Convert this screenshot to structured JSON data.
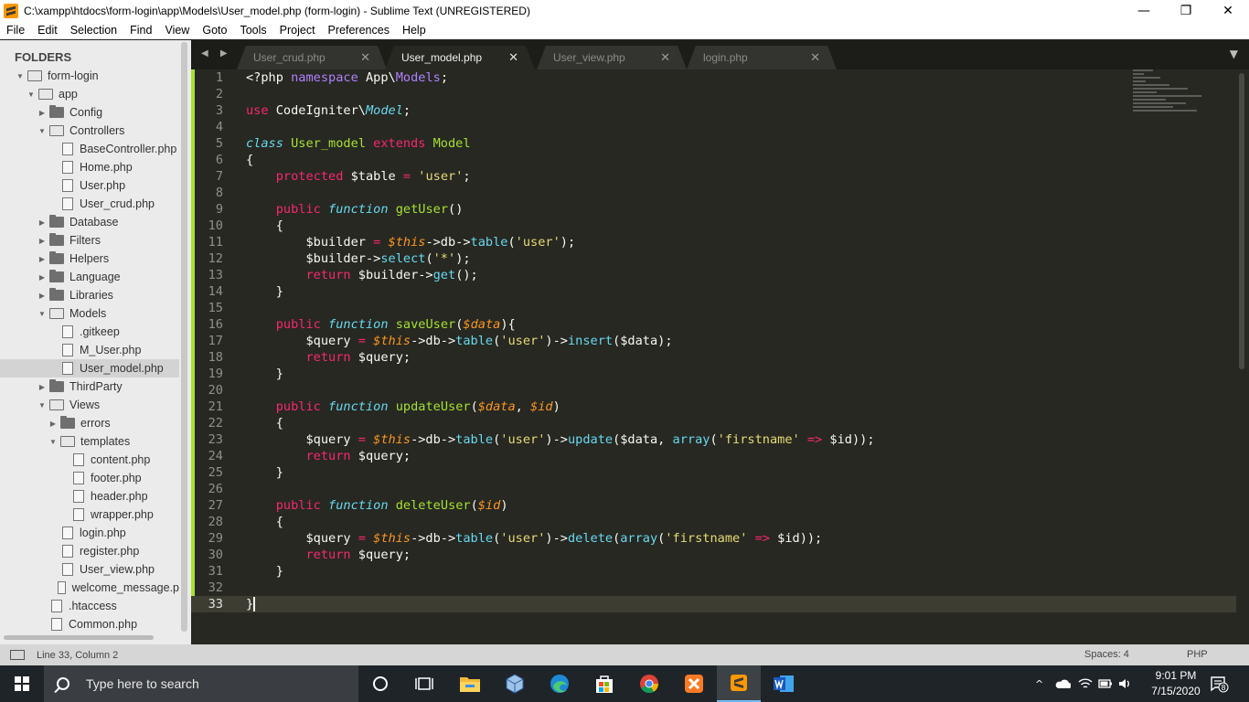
{
  "window": {
    "title": "C:\\xampp\\htdocs\\form-login\\app\\Models\\User_model.php (form-login) - Sublime Text (UNREGISTERED)",
    "minimize": "—",
    "maximize": "❐",
    "close": "✕"
  },
  "menu": [
    "File",
    "Edit",
    "Selection",
    "Find",
    "View",
    "Goto",
    "Tools",
    "Project",
    "Preferences",
    "Help"
  ],
  "sidebar": {
    "title": "FOLDERS",
    "tree": [
      {
        "label": "form-login",
        "type": "folder-open",
        "depth": 0,
        "twisty": "▼"
      },
      {
        "label": "app",
        "type": "folder-open",
        "depth": 1,
        "twisty": "▼"
      },
      {
        "label": "Config",
        "type": "folder",
        "depth": 2,
        "twisty": "▶"
      },
      {
        "label": "Controllers",
        "type": "folder-open",
        "depth": 2,
        "twisty": "▼"
      },
      {
        "label": "BaseController.php",
        "type": "file",
        "depth": 3
      },
      {
        "label": "Home.php",
        "type": "file",
        "depth": 3
      },
      {
        "label": "User.php",
        "type": "file",
        "depth": 3
      },
      {
        "label": "User_crud.php",
        "type": "file",
        "depth": 3
      },
      {
        "label": "Database",
        "type": "folder",
        "depth": 2,
        "twisty": "▶"
      },
      {
        "label": "Filters",
        "type": "folder",
        "depth": 2,
        "twisty": "▶"
      },
      {
        "label": "Helpers",
        "type": "folder",
        "depth": 2,
        "twisty": "▶"
      },
      {
        "label": "Language",
        "type": "folder",
        "depth": 2,
        "twisty": "▶"
      },
      {
        "label": "Libraries",
        "type": "folder",
        "depth": 2,
        "twisty": "▶"
      },
      {
        "label": "Models",
        "type": "folder-open",
        "depth": 2,
        "twisty": "▼"
      },
      {
        "label": ".gitkeep",
        "type": "file",
        "depth": 3
      },
      {
        "label": "M_User.php",
        "type": "file",
        "depth": 3
      },
      {
        "label": "User_model.php",
        "type": "file",
        "depth": 3,
        "selected": true
      },
      {
        "label": "ThirdParty",
        "type": "folder",
        "depth": 2,
        "twisty": "▶"
      },
      {
        "label": "Views",
        "type": "folder-open",
        "depth": 2,
        "twisty": "▼"
      },
      {
        "label": "errors",
        "type": "folder",
        "depth": 3,
        "twisty": "▶"
      },
      {
        "label": "templates",
        "type": "folder-open",
        "depth": 3,
        "twisty": "▼"
      },
      {
        "label": "content.php",
        "type": "file",
        "depth": 4
      },
      {
        "label": "footer.php",
        "type": "file",
        "depth": 4
      },
      {
        "label": "header.php",
        "type": "file",
        "depth": 4
      },
      {
        "label": "wrapper.php",
        "type": "file",
        "depth": 4
      },
      {
        "label": "login.php",
        "type": "file",
        "depth": 3
      },
      {
        "label": "register.php",
        "type": "file",
        "depth": 3
      },
      {
        "label": "User_view.php",
        "type": "file",
        "depth": 3
      },
      {
        "label": "welcome_message.p",
        "type": "file",
        "depth": 3
      },
      {
        "label": ".htaccess",
        "type": "file",
        "depth": 2
      },
      {
        "label": "Common.php",
        "type": "file",
        "depth": 2
      }
    ]
  },
  "tabs": {
    "nav": "◀ ▶",
    "dropdown": "▼",
    "close": "✕",
    "items": [
      {
        "label": "User_crud.php",
        "active": false
      },
      {
        "label": "User_model.php",
        "active": true
      },
      {
        "label": "User_view.php",
        "active": false
      },
      {
        "label": "login.php",
        "active": false
      }
    ]
  },
  "editor": {
    "current_line": 33,
    "lines": [
      [
        {
          "t": "<?php "
        },
        {
          "t": "namespace",
          "c": "st"
        },
        {
          "t": " App\\"
        },
        {
          "t": "Models",
          "c": "st"
        },
        {
          "t": ";"
        }
      ],
      [],
      [
        {
          "t": "use",
          "c": "k"
        },
        {
          "t": " CodeIgniter\\"
        },
        {
          "t": "Model",
          "c": "t"
        },
        {
          "t": ";"
        }
      ],
      [],
      [
        {
          "t": "class",
          "c": "t"
        },
        {
          "t": " "
        },
        {
          "t": "User_model",
          "c": "f"
        },
        {
          "t": " "
        },
        {
          "t": "extends",
          "c": "k"
        },
        {
          "t": " "
        },
        {
          "t": "Model",
          "c": "f"
        }
      ],
      [
        {
          "t": "{"
        }
      ],
      [
        {
          "t": "    "
        },
        {
          "t": "protected",
          "c": "k"
        },
        {
          "t": " $table "
        },
        {
          "t": "=",
          "c": "k"
        },
        {
          "t": " "
        },
        {
          "t": "'user'",
          "c": "s"
        },
        {
          "t": ";"
        }
      ],
      [],
      [
        {
          "t": "    "
        },
        {
          "t": "public",
          "c": "k"
        },
        {
          "t": " "
        },
        {
          "t": "function",
          "c": "t"
        },
        {
          "t": " "
        },
        {
          "t": "getUser",
          "c": "f"
        },
        {
          "t": "()"
        }
      ],
      [
        {
          "t": "    {"
        }
      ],
      [
        {
          "t": "        $builder "
        },
        {
          "t": "=",
          "c": "k"
        },
        {
          "t": " "
        },
        {
          "t": "$this",
          "c": "p"
        },
        {
          "t": "->db->"
        },
        {
          "t": "table",
          "c": "c"
        },
        {
          "t": "("
        },
        {
          "t": "'user'",
          "c": "s"
        },
        {
          "t": ");"
        }
      ],
      [
        {
          "t": "        $builder->"
        },
        {
          "t": "select",
          "c": "c"
        },
        {
          "t": "("
        },
        {
          "t": "'*'",
          "c": "s"
        },
        {
          "t": ");"
        }
      ],
      [
        {
          "t": "        "
        },
        {
          "t": "return",
          "c": "k"
        },
        {
          "t": " $builder->"
        },
        {
          "t": "get",
          "c": "c"
        },
        {
          "t": "();"
        }
      ],
      [
        {
          "t": "    }"
        }
      ],
      [],
      [
        {
          "t": "    "
        },
        {
          "t": "public",
          "c": "k"
        },
        {
          "t": " "
        },
        {
          "t": "function",
          "c": "t"
        },
        {
          "t": " "
        },
        {
          "t": "saveUser",
          "c": "f"
        },
        {
          "t": "("
        },
        {
          "t": "$data",
          "c": "p"
        },
        {
          "t": "){"
        }
      ],
      [
        {
          "t": "        $query "
        },
        {
          "t": "=",
          "c": "k"
        },
        {
          "t": " "
        },
        {
          "t": "$this",
          "c": "p"
        },
        {
          "t": "->db->"
        },
        {
          "t": "table",
          "c": "c"
        },
        {
          "t": "("
        },
        {
          "t": "'user'",
          "c": "s"
        },
        {
          "t": ")->"
        },
        {
          "t": "insert",
          "c": "c"
        },
        {
          "t": "($data);"
        }
      ],
      [
        {
          "t": "        "
        },
        {
          "t": "return",
          "c": "k"
        },
        {
          "t": " $query;"
        }
      ],
      [
        {
          "t": "    }"
        }
      ],
      [],
      [
        {
          "t": "    "
        },
        {
          "t": "public",
          "c": "k"
        },
        {
          "t": " "
        },
        {
          "t": "function",
          "c": "t"
        },
        {
          "t": " "
        },
        {
          "t": "updateUser",
          "c": "f"
        },
        {
          "t": "("
        },
        {
          "t": "$data",
          "c": "p"
        },
        {
          "t": ", "
        },
        {
          "t": "$id",
          "c": "p"
        },
        {
          "t": ")"
        }
      ],
      [
        {
          "t": "    {"
        }
      ],
      [
        {
          "t": "        $query "
        },
        {
          "t": "=",
          "c": "k"
        },
        {
          "t": " "
        },
        {
          "t": "$this",
          "c": "p"
        },
        {
          "t": "->db->"
        },
        {
          "t": "table",
          "c": "c"
        },
        {
          "t": "("
        },
        {
          "t": "'user'",
          "c": "s"
        },
        {
          "t": ")->"
        },
        {
          "t": "update",
          "c": "c"
        },
        {
          "t": "($data, "
        },
        {
          "t": "array",
          "c": "c"
        },
        {
          "t": "("
        },
        {
          "t": "'firstname'",
          "c": "s"
        },
        {
          "t": " "
        },
        {
          "t": "=>",
          "c": "k"
        },
        {
          "t": " $id));"
        }
      ],
      [
        {
          "t": "        "
        },
        {
          "t": "return",
          "c": "k"
        },
        {
          "t": " $query;"
        }
      ],
      [
        {
          "t": "    }"
        }
      ],
      [],
      [
        {
          "t": "    "
        },
        {
          "t": "public",
          "c": "k"
        },
        {
          "t": " "
        },
        {
          "t": "function",
          "c": "t"
        },
        {
          "t": " "
        },
        {
          "t": "deleteUser",
          "c": "f"
        },
        {
          "t": "("
        },
        {
          "t": "$id",
          "c": "p"
        },
        {
          "t": ")"
        }
      ],
      [
        {
          "t": "    {"
        }
      ],
      [
        {
          "t": "        $query "
        },
        {
          "t": "=",
          "c": "k"
        },
        {
          "t": " "
        },
        {
          "t": "$this",
          "c": "p"
        },
        {
          "t": "->db->"
        },
        {
          "t": "table",
          "c": "c"
        },
        {
          "t": "("
        },
        {
          "t": "'user'",
          "c": "s"
        },
        {
          "t": ")->"
        },
        {
          "t": "delete",
          "c": "c"
        },
        {
          "t": "("
        },
        {
          "t": "array",
          "c": "c"
        },
        {
          "t": "("
        },
        {
          "t": "'firstname'",
          "c": "s"
        },
        {
          "t": " "
        },
        {
          "t": "=>",
          "c": "k"
        },
        {
          "t": " $id));"
        }
      ],
      [
        {
          "t": "        "
        },
        {
          "t": "return",
          "c": "k"
        },
        {
          "t": " $query;"
        }
      ],
      [
        {
          "t": "    }"
        }
      ],
      [],
      [
        {
          "t": "}"
        }
      ]
    ]
  },
  "status": {
    "position": "Line 33, Column 2",
    "indent": "Spaces: 4",
    "syntax": "PHP"
  },
  "taskbar": {
    "search_placeholder": "Type here to search",
    "time": "9:01 PM",
    "date": "7/15/2020",
    "notifications": "8",
    "apps": [
      "cortana-icon",
      "task-view-icon",
      "file-explorer-icon",
      "virtualbox-icon",
      "edge-icon",
      "store-icon",
      "chrome-icon",
      "xampp-icon",
      "sublime-text-icon",
      "word-icon"
    ]
  },
  "colors": {
    "editor_bg": "#272822",
    "tabbar_bg": "#1c1d18",
    "sidebar_bg": "#ebebeb",
    "keyword": "#f92672",
    "string": "#e6db74",
    "function_name": "#a6e22e",
    "storage_type": "#66d9ef",
    "parameter": "#fd971f",
    "constant": "#ae81ff"
  }
}
